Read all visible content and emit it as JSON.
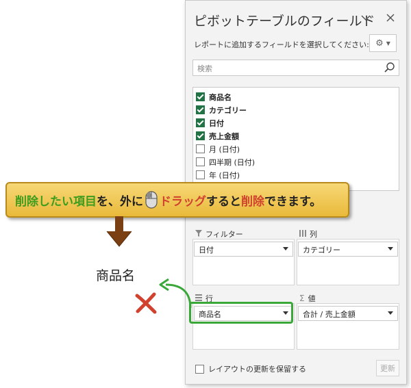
{
  "panel": {
    "title": "ピボットテーブルのフィールド",
    "instruction": "レポートに追加するフィールドを選択してください:",
    "search_placeholder": "検索",
    "fields": [
      {
        "label": "商品名",
        "checked": true
      },
      {
        "label": "カテゴリー",
        "checked": true
      },
      {
        "label": "日付",
        "checked": true
      },
      {
        "label": "売上金額",
        "checked": true
      },
      {
        "label": "月 (日付)",
        "checked": false
      },
      {
        "label": "四半期 (日付)",
        "checked": false
      },
      {
        "label": "年 (日付)",
        "checked": false
      }
    ],
    "areas": {
      "filter": {
        "title": "フィルター",
        "item": "日付"
      },
      "columns": {
        "title": "列",
        "item": "カテゴリー"
      },
      "rows": {
        "title": "行",
        "item": "商品名"
      },
      "values": {
        "title": "値",
        "item": "合計 / 売上金額"
      }
    },
    "defer_label": "レイアウトの更新を保留する",
    "update_label": "更新"
  },
  "banner": {
    "part1": "削除したい項目",
    "part2": "を、外に",
    "part3": "ドラッグ",
    "part4": "すると",
    "part5": "削除",
    "part6": "できます。"
  },
  "dragged_label": "商品名",
  "colors": {
    "accent_green": "#217346",
    "highlight": "#3aa839",
    "delete_x": "#d0422e"
  }
}
